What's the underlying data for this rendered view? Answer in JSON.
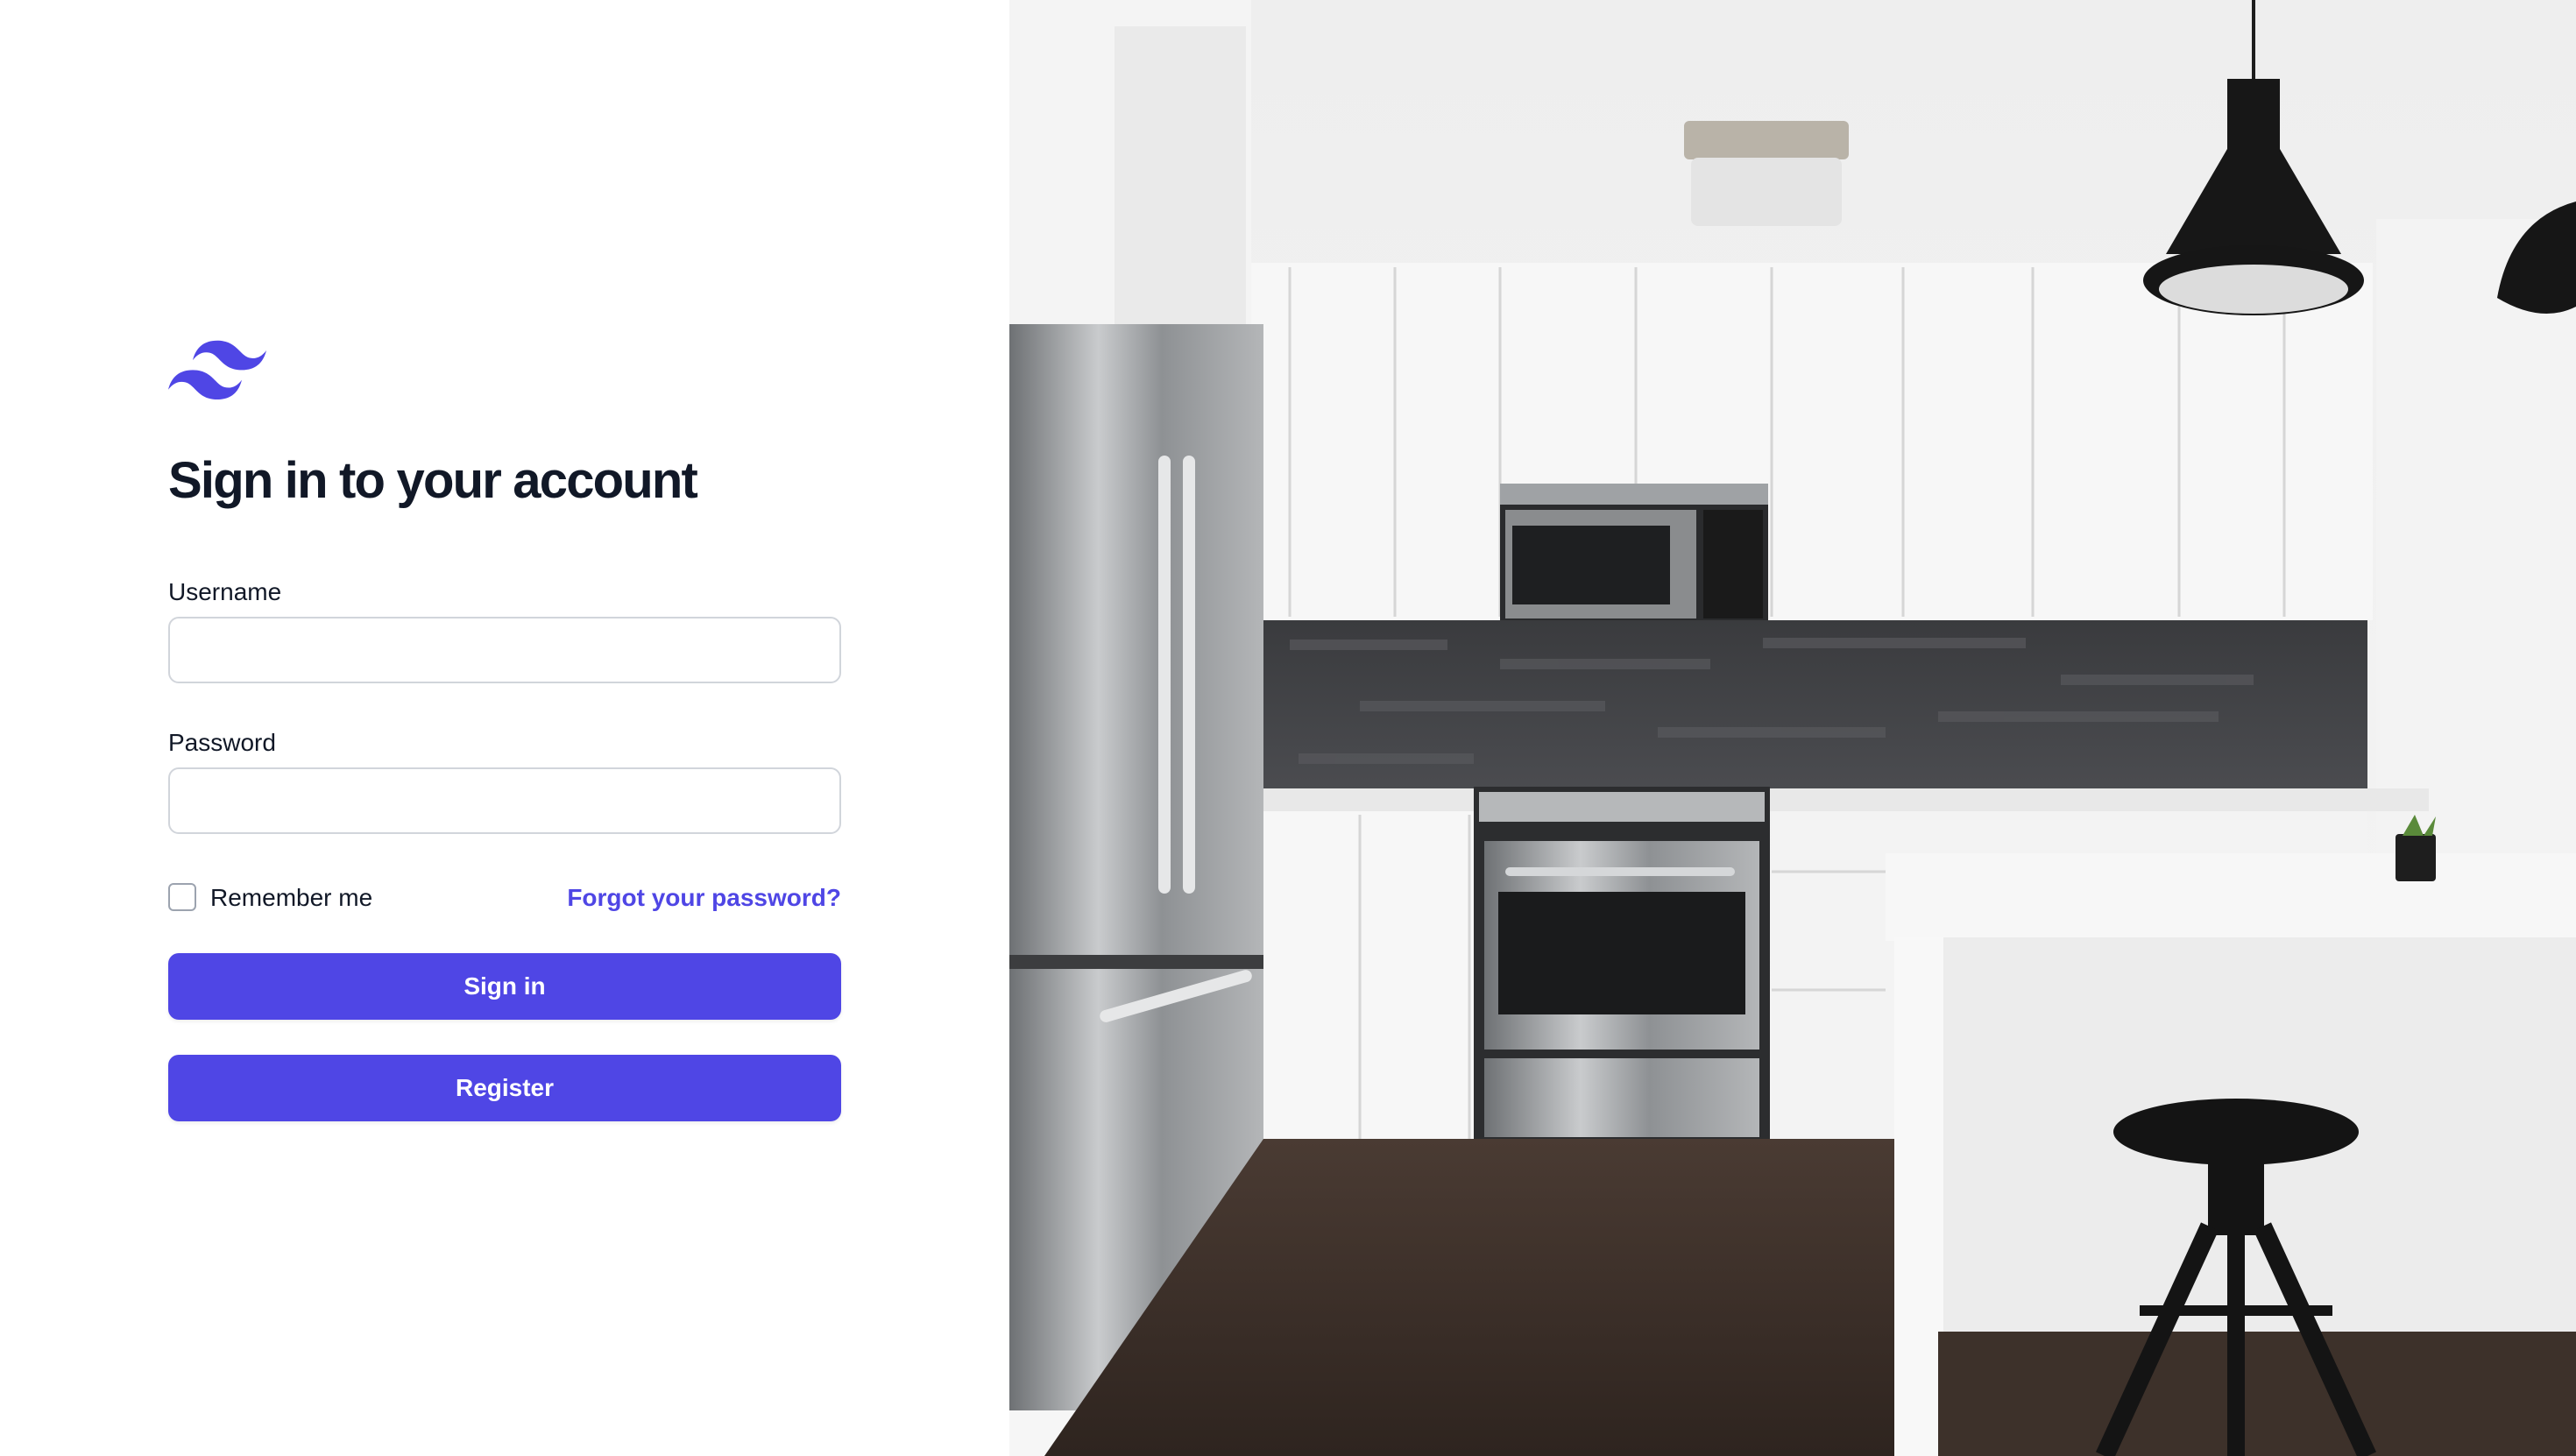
{
  "brand": {
    "logo_icon": "tailwind-wave-icon",
    "color": "#4f46e5"
  },
  "title": "Sign in to your account",
  "form": {
    "username": {
      "label": "Username",
      "value": "",
      "placeholder": ""
    },
    "password": {
      "label": "Password",
      "value": "",
      "placeholder": ""
    },
    "remember": {
      "label": "Remember me",
      "checked": false
    },
    "forgot_link": "Forgot your password?",
    "signin_label": "Sign in",
    "register_label": "Register"
  },
  "hero": {
    "subject": "kitchen-photo"
  },
  "colors": {
    "accent": "#4f46e5",
    "text": "#111827",
    "border": "#d1d5db"
  }
}
